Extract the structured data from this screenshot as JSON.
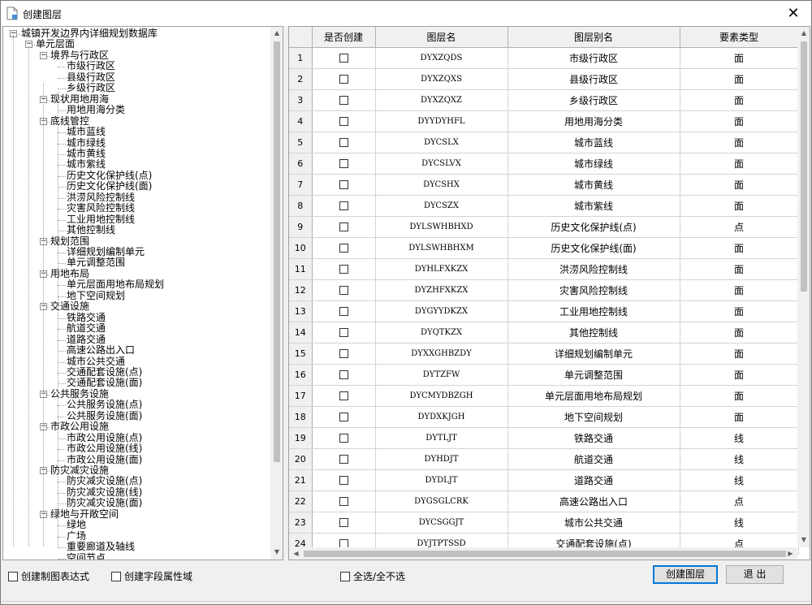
{
  "window": {
    "title": "创建图层",
    "close": "✕"
  },
  "tree": {
    "nodes": [
      {
        "label": "城镇开发边界内详细规划数据库",
        "level": 0,
        "expander": "−"
      },
      {
        "label": "单元层面",
        "level": 1,
        "expander": "−"
      },
      {
        "label": "境界与行政区",
        "level": 2,
        "expander": "−"
      },
      {
        "label": "市级行政区",
        "level": 3
      },
      {
        "label": "县级行政区",
        "level": 3
      },
      {
        "label": "乡级行政区",
        "level": 3
      },
      {
        "label": "现状用地用海",
        "level": 2,
        "expander": "−"
      },
      {
        "label": "用地用海分类",
        "level": 3
      },
      {
        "label": "底线管控",
        "level": 2,
        "expander": "−"
      },
      {
        "label": "城市蓝线",
        "level": 3
      },
      {
        "label": "城市绿线",
        "level": 3
      },
      {
        "label": "城市黄线",
        "level": 3
      },
      {
        "label": "城市紫线",
        "level": 3
      },
      {
        "label": "历史文化保护线(点)",
        "level": 3
      },
      {
        "label": "历史文化保护线(面)",
        "level": 3
      },
      {
        "label": "洪涝风险控制线",
        "level": 3
      },
      {
        "label": "灾害风险控制线",
        "level": 3
      },
      {
        "label": "工业用地控制线",
        "level": 3
      },
      {
        "label": "其他控制线",
        "level": 3
      },
      {
        "label": "规划范围",
        "level": 2,
        "expander": "−"
      },
      {
        "label": "详细规划编制单元",
        "level": 3
      },
      {
        "label": "单元调整范围",
        "level": 3
      },
      {
        "label": "用地布局",
        "level": 2,
        "expander": "−"
      },
      {
        "label": "单元层面用地布局规划",
        "level": 3
      },
      {
        "label": "地下空间规划",
        "level": 3
      },
      {
        "label": "交通设施",
        "level": 2,
        "expander": "−"
      },
      {
        "label": "铁路交通",
        "level": 3
      },
      {
        "label": "航道交通",
        "level": 3
      },
      {
        "label": "道路交通",
        "level": 3
      },
      {
        "label": "高速公路出入口",
        "level": 3
      },
      {
        "label": "城市公共交通",
        "level": 3
      },
      {
        "label": "交通配套设施(点)",
        "level": 3
      },
      {
        "label": "交通配套设施(面)",
        "level": 3
      },
      {
        "label": "公共服务设施",
        "level": 2,
        "expander": "−"
      },
      {
        "label": "公共服务设施(点)",
        "level": 3
      },
      {
        "label": "公共服务设施(面)",
        "level": 3
      },
      {
        "label": "市政公用设施",
        "level": 2,
        "expander": "−"
      },
      {
        "label": "市政公用设施(点)",
        "level": 3
      },
      {
        "label": "市政公用设施(线)",
        "level": 3
      },
      {
        "label": "市政公用设施(面)",
        "level": 3
      },
      {
        "label": "防灾减灾设施",
        "level": 2,
        "expander": "−"
      },
      {
        "label": "防灾减灾设施(点)",
        "level": 3
      },
      {
        "label": "防灾减灾设施(线)",
        "level": 3
      },
      {
        "label": "防灾减灾设施(面)",
        "level": 3
      },
      {
        "label": "绿地与开敞空间",
        "level": 2,
        "expander": "−"
      },
      {
        "label": "绿地",
        "level": 3
      },
      {
        "label": "广场",
        "level": 3
      },
      {
        "label": "重要廊道及轴线",
        "level": 3
      },
      {
        "label": "空间节点",
        "level": 3
      }
    ]
  },
  "grid": {
    "columns": [
      "是否创建",
      "图层名",
      "图层别名",
      "要素类型"
    ],
    "rows": [
      {
        "n": "1",
        "code": "DYXZQDS",
        "alias": "市级行政区",
        "type": "面"
      },
      {
        "n": "2",
        "code": "DYXZQXS",
        "alias": "县级行政区",
        "type": "面"
      },
      {
        "n": "3",
        "code": "DYXZQXZ",
        "alias": "乡级行政区",
        "type": "面"
      },
      {
        "n": "4",
        "code": "DYYDYHFL",
        "alias": "用地用海分类",
        "type": "面"
      },
      {
        "n": "5",
        "code": "DYCSLX",
        "alias": "城市蓝线",
        "type": "面"
      },
      {
        "n": "6",
        "code": "DYCSLVX",
        "alias": "城市绿线",
        "type": "面"
      },
      {
        "n": "7",
        "code": "DYCSHX",
        "alias": "城市黄线",
        "type": "面"
      },
      {
        "n": "8",
        "code": "DYCSZX",
        "alias": "城市紫线",
        "type": "面"
      },
      {
        "n": "9",
        "code": "DYLSWHBHXD",
        "alias": "历史文化保护线(点)",
        "type": "点"
      },
      {
        "n": "10",
        "code": "DYLSWHBHXM",
        "alias": "历史文化保护线(面)",
        "type": "面"
      },
      {
        "n": "11",
        "code": "DYHLFXKZX",
        "alias": "洪涝风险控制线",
        "type": "面"
      },
      {
        "n": "12",
        "code": "DYZHFXKZX",
        "alias": "灾害风险控制线",
        "type": "面"
      },
      {
        "n": "13",
        "code": "DYGYYDKZX",
        "alias": "工业用地控制线",
        "type": "面"
      },
      {
        "n": "14",
        "code": "DYQTKZX",
        "alias": "其他控制线",
        "type": "面"
      },
      {
        "n": "15",
        "code": "DYXXGHBZDY",
        "alias": "详细规划编制单元",
        "type": "面"
      },
      {
        "n": "16",
        "code": "DYTZFW",
        "alias": "单元调整范围",
        "type": "面"
      },
      {
        "n": "17",
        "code": "DYCMYDBZGH",
        "alias": "单元层面用地布局规划",
        "type": "面"
      },
      {
        "n": "18",
        "code": "DYDXKJGH",
        "alias": "地下空间规划",
        "type": "面"
      },
      {
        "n": "19",
        "code": "DYTLJT",
        "alias": "铁路交通",
        "type": "线"
      },
      {
        "n": "20",
        "code": "DYHDJT",
        "alias": "航道交通",
        "type": "线"
      },
      {
        "n": "21",
        "code": "DYDLJT",
        "alias": "道路交通",
        "type": "线"
      },
      {
        "n": "22",
        "code": "DYGSGLCRK",
        "alias": "高速公路出入口",
        "type": "点"
      },
      {
        "n": "23",
        "code": "DYCSGGJT",
        "alias": "城市公共交通",
        "type": "线"
      },
      {
        "n": "24",
        "code": "DYJTPTSSD",
        "alias": "交通配套设施(点)",
        "type": "点"
      }
    ]
  },
  "footer": {
    "create_style_label": "创建制图表达式",
    "create_field_label": "创建字段属性域",
    "select_all_label": "全选/全不选",
    "create_button": "创建图层",
    "exit_button": "退 出"
  }
}
